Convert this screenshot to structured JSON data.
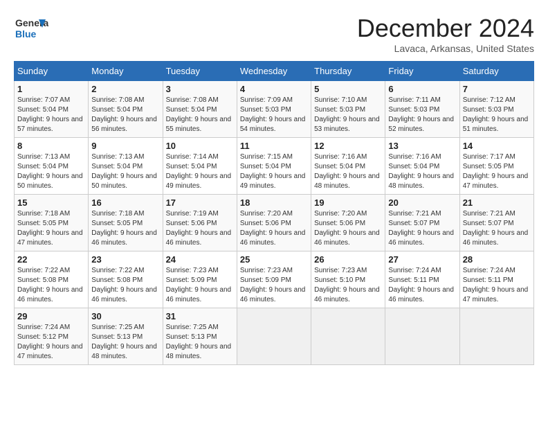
{
  "logo": {
    "general": "General",
    "blue": "Blue"
  },
  "title": "December 2024",
  "subtitle": "Lavaca, Arkansas, United States",
  "days_of_week": [
    "Sunday",
    "Monday",
    "Tuesday",
    "Wednesday",
    "Thursday",
    "Friday",
    "Saturday"
  ],
  "weeks": [
    [
      {
        "day": "1",
        "sunrise": "7:07 AM",
        "sunset": "5:04 PM",
        "daylight": "9 hours and 57 minutes."
      },
      {
        "day": "2",
        "sunrise": "7:08 AM",
        "sunset": "5:04 PM",
        "daylight": "9 hours and 56 minutes."
      },
      {
        "day": "3",
        "sunrise": "7:08 AM",
        "sunset": "5:04 PM",
        "daylight": "9 hours and 55 minutes."
      },
      {
        "day": "4",
        "sunrise": "7:09 AM",
        "sunset": "5:03 PM",
        "daylight": "9 hours and 54 minutes."
      },
      {
        "day": "5",
        "sunrise": "7:10 AM",
        "sunset": "5:03 PM",
        "daylight": "9 hours and 53 minutes."
      },
      {
        "day": "6",
        "sunrise": "7:11 AM",
        "sunset": "5:03 PM",
        "daylight": "9 hours and 52 minutes."
      },
      {
        "day": "7",
        "sunrise": "7:12 AM",
        "sunset": "5:03 PM",
        "daylight": "9 hours and 51 minutes."
      }
    ],
    [
      {
        "day": "8",
        "sunrise": "7:13 AM",
        "sunset": "5:04 PM",
        "daylight": "9 hours and 50 minutes."
      },
      {
        "day": "9",
        "sunrise": "7:13 AM",
        "sunset": "5:04 PM",
        "daylight": "9 hours and 50 minutes."
      },
      {
        "day": "10",
        "sunrise": "7:14 AM",
        "sunset": "5:04 PM",
        "daylight": "9 hours and 49 minutes."
      },
      {
        "day": "11",
        "sunrise": "7:15 AM",
        "sunset": "5:04 PM",
        "daylight": "9 hours and 49 minutes."
      },
      {
        "day": "12",
        "sunrise": "7:16 AM",
        "sunset": "5:04 PM",
        "daylight": "9 hours and 48 minutes."
      },
      {
        "day": "13",
        "sunrise": "7:16 AM",
        "sunset": "5:04 PM",
        "daylight": "9 hours and 48 minutes."
      },
      {
        "day": "14",
        "sunrise": "7:17 AM",
        "sunset": "5:05 PM",
        "daylight": "9 hours and 47 minutes."
      }
    ],
    [
      {
        "day": "15",
        "sunrise": "7:18 AM",
        "sunset": "5:05 PM",
        "daylight": "9 hours and 47 minutes."
      },
      {
        "day": "16",
        "sunrise": "7:18 AM",
        "sunset": "5:05 PM",
        "daylight": "9 hours and 46 minutes."
      },
      {
        "day": "17",
        "sunrise": "7:19 AM",
        "sunset": "5:06 PM",
        "daylight": "9 hours and 46 minutes."
      },
      {
        "day": "18",
        "sunrise": "7:20 AM",
        "sunset": "5:06 PM",
        "daylight": "9 hours and 46 minutes."
      },
      {
        "day": "19",
        "sunrise": "7:20 AM",
        "sunset": "5:06 PM",
        "daylight": "9 hours and 46 minutes."
      },
      {
        "day": "20",
        "sunrise": "7:21 AM",
        "sunset": "5:07 PM",
        "daylight": "9 hours and 46 minutes."
      },
      {
        "day": "21",
        "sunrise": "7:21 AM",
        "sunset": "5:07 PM",
        "daylight": "9 hours and 46 minutes."
      }
    ],
    [
      {
        "day": "22",
        "sunrise": "7:22 AM",
        "sunset": "5:08 PM",
        "daylight": "9 hours and 46 minutes."
      },
      {
        "day": "23",
        "sunrise": "7:22 AM",
        "sunset": "5:08 PM",
        "daylight": "9 hours and 46 minutes."
      },
      {
        "day": "24",
        "sunrise": "7:23 AM",
        "sunset": "5:09 PM",
        "daylight": "9 hours and 46 minutes."
      },
      {
        "day": "25",
        "sunrise": "7:23 AM",
        "sunset": "5:09 PM",
        "daylight": "9 hours and 46 minutes."
      },
      {
        "day": "26",
        "sunrise": "7:23 AM",
        "sunset": "5:10 PM",
        "daylight": "9 hours and 46 minutes."
      },
      {
        "day": "27",
        "sunrise": "7:24 AM",
        "sunset": "5:11 PM",
        "daylight": "9 hours and 46 minutes."
      },
      {
        "day": "28",
        "sunrise": "7:24 AM",
        "sunset": "5:11 PM",
        "daylight": "9 hours and 47 minutes."
      }
    ],
    [
      {
        "day": "29",
        "sunrise": "7:24 AM",
        "sunset": "5:12 PM",
        "daylight": "9 hours and 47 minutes."
      },
      {
        "day": "30",
        "sunrise": "7:25 AM",
        "sunset": "5:13 PM",
        "daylight": "9 hours and 48 minutes."
      },
      {
        "day": "31",
        "sunrise": "7:25 AM",
        "sunset": "5:13 PM",
        "daylight": "9 hours and 48 minutes."
      },
      null,
      null,
      null,
      null
    ]
  ]
}
